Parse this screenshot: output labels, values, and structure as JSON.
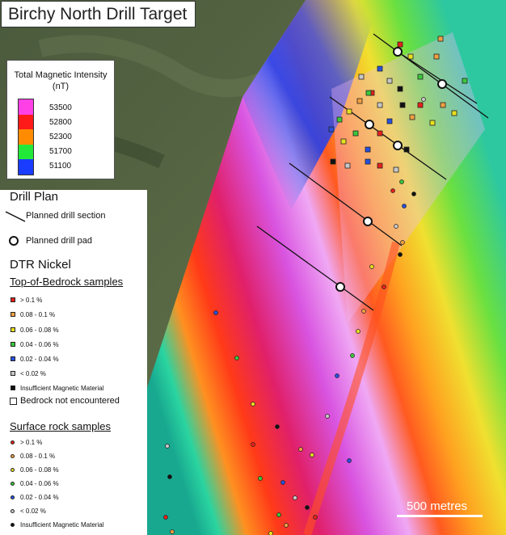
{
  "title": "Birchy North Drill Target",
  "magnetic_legend": {
    "title_line1": "Total Magnetic Intensity",
    "title_line2": "(nT)",
    "classes": [
      {
        "label": "53500",
        "color": "#ff40e6"
      },
      {
        "label": "52800",
        "color": "#ff1a1a"
      },
      {
        "label": "52300",
        "color": "#ff8c00"
      },
      {
        "label": "51700",
        "color": "#22e83a"
      },
      {
        "label": "51100",
        "color": "#1a3cff"
      }
    ]
  },
  "drill_plan": {
    "heading": "Drill Plan",
    "section_label": "Planned drill section",
    "pad_label": "Planned drill pad"
  },
  "dtr": {
    "heading": "DTR Nickel",
    "bedrock_heading": "Top-of-Bedrock samples",
    "bedrock_classes": [
      {
        "label": "> 0.1 %",
        "color": "#e8201a"
      },
      {
        "label": "0.08 - 0.1 %",
        "color": "#f2a040"
      },
      {
        "label": "0.06 - 0.08 %",
        "color": "#e8e020"
      },
      {
        "label": "0.04 - 0.06 %",
        "color": "#3cc83c"
      },
      {
        "label": "0.02 - 0.04 %",
        "color": "#2850e0"
      },
      {
        "label": "< 0.02 %",
        "color": "#c8c8c8"
      },
      {
        "label": "Insufficient Magnetic Material",
        "color": "#111111"
      },
      {
        "label": "Bedrock not encountered",
        "color": "#ffffff"
      }
    ],
    "surface_heading": "Surface rock samples",
    "surface_classes": [
      {
        "label": "> 0.1 %",
        "color": "#e8201a"
      },
      {
        "label": "0.08 - 0.1 %",
        "color": "#f2a040"
      },
      {
        "label": "0.06 - 0.08 %",
        "color": "#e8e020"
      },
      {
        "label": "0.04 - 0.06 %",
        "color": "#3cc83c"
      },
      {
        "label": "0.02 - 0.04 %",
        "color": "#2850e0"
      },
      {
        "label": "< 0.02 %",
        "color": "#c8c8c8"
      },
      {
        "label": "Insufficient Magnetic Material",
        "color": "#111111"
      }
    ]
  },
  "scale_bar": {
    "label": "500 metres"
  },
  "map_samples": {
    "surface_dots": 45,
    "bedrock_squares": 55,
    "drill_pads": 8,
    "drill_sections": 6
  }
}
